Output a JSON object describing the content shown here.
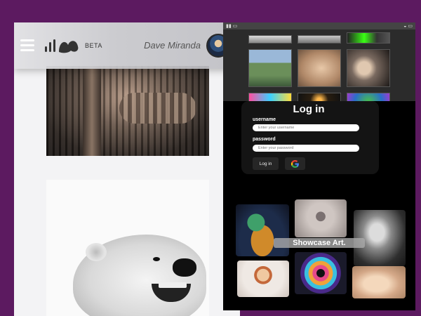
{
  "app": {
    "beta_label": "BETA",
    "user_name": "Dave Miranda"
  },
  "login": {
    "title": "Log in",
    "username_label": "username",
    "username_placeholder": "Enter your username",
    "password_label": "password",
    "password_placeholder": "Enter your password",
    "login_button": "Log in",
    "google_icon": "google-icon"
  },
  "showcase": {
    "banner": "Showcase Art."
  },
  "colors": {
    "background": "#5c1a60",
    "left_screen": "#f3f3f5",
    "right_screen": "#000000"
  }
}
